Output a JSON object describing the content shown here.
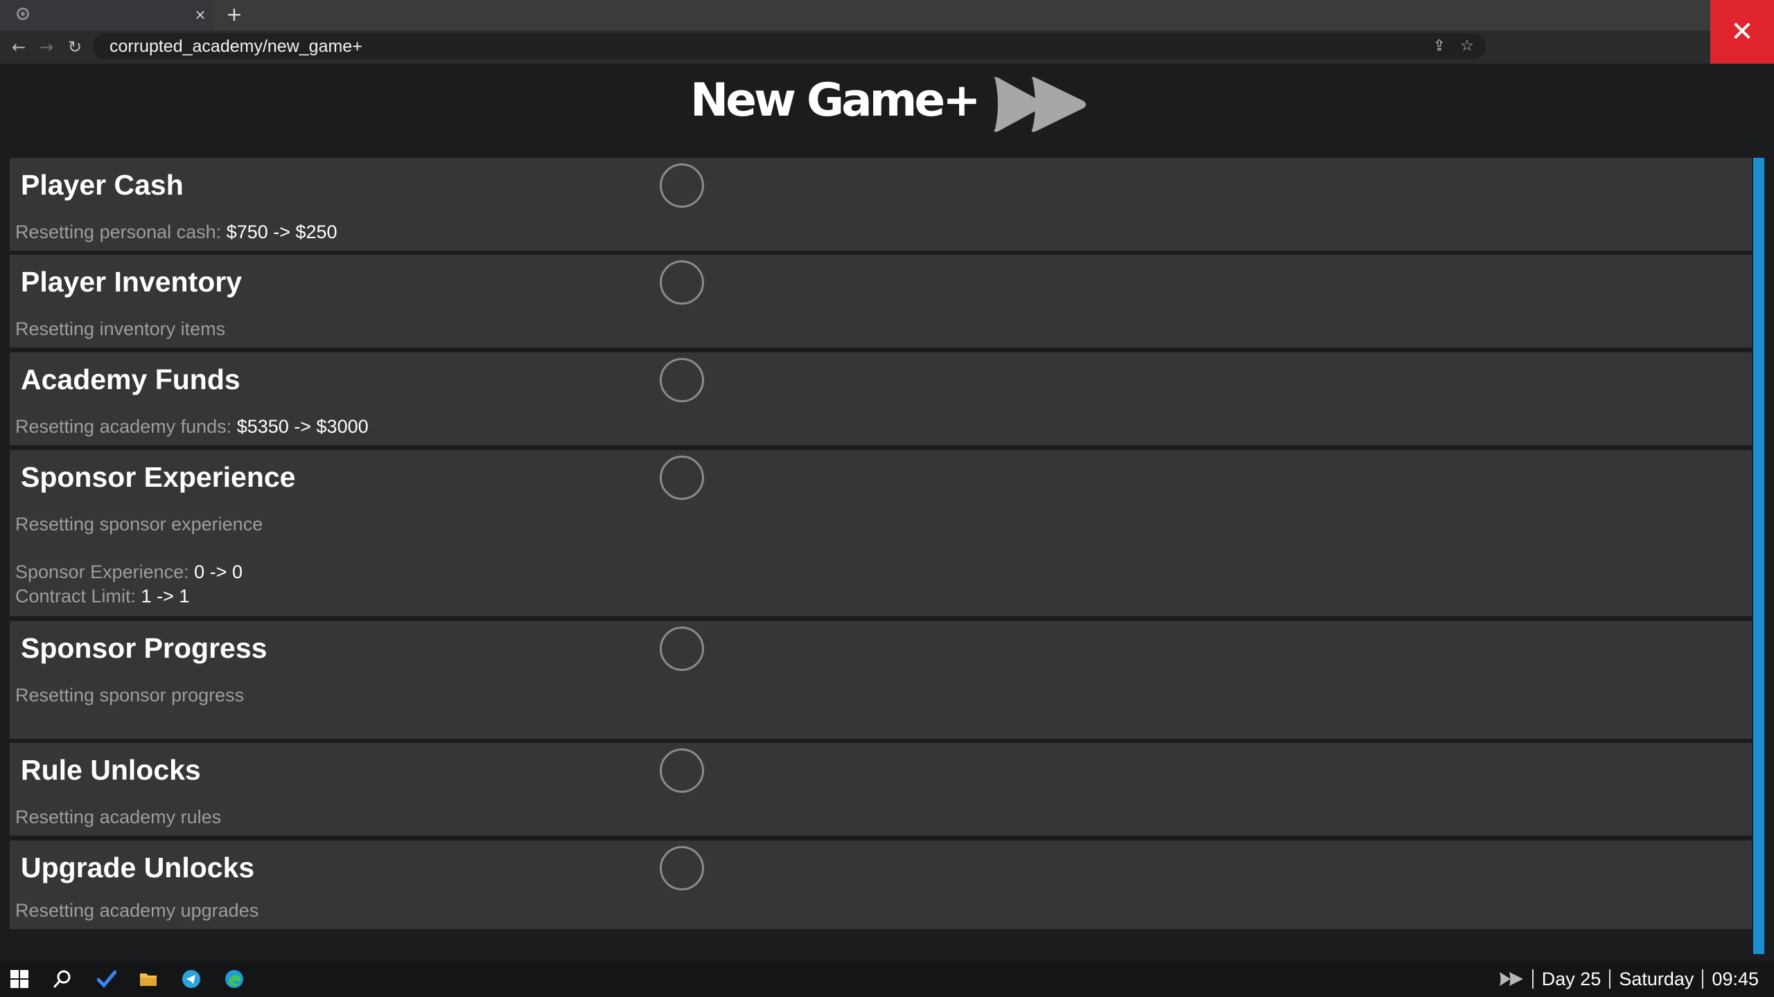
{
  "browser": {
    "tab_close": "×",
    "new_tab": "+",
    "url": "corrupted_academy/new_game+",
    "window_close": "✕"
  },
  "header": {
    "title": "New Game+",
    "icon": "fast-forward-icon"
  },
  "rows": [
    {
      "title": "Player Cash",
      "desc": "Resetting personal cash:",
      "value": "$750 -> $250"
    },
    {
      "title": "Player Inventory",
      "desc": "Resetting inventory items"
    },
    {
      "title": "Academy Funds",
      "desc": "Resetting academy funds:",
      "value": "$5350 -> $3000"
    },
    {
      "title": "Sponsor Experience",
      "desc": "Resetting sponsor experience",
      "extra": [
        {
          "label": "Sponsor Experience:",
          "value": "0 -> 0"
        },
        {
          "label": "Contract Limit:",
          "value": "1 -> 1"
        }
      ]
    },
    {
      "title": "Sponsor Progress",
      "desc": "Resetting sponsor progress"
    },
    {
      "title": "Rule Unlocks",
      "desc": "Resetting academy rules"
    },
    {
      "title": "Upgrade Unlocks",
      "desc": "Resetting academy upgrades"
    }
  ],
  "taskbar": {
    "icons": [
      "windows-start-icon",
      "search-icon",
      "checkmark-app-icon",
      "file-explorer-icon",
      "telegram-icon",
      "edge-icon"
    ],
    "day": "Day 25",
    "weekday": "Saturday",
    "time": "09:45"
  },
  "colors": {
    "accent_scrollbar": "#1c8ed0",
    "close_button": "#e0242d",
    "row_background": "#353638"
  }
}
